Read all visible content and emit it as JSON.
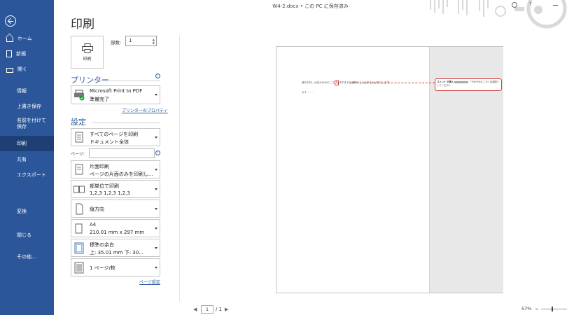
{
  "title_bar": "W4-2.docx • この PC に保存済み",
  "page_title": "印刷",
  "nav": {
    "items": [
      {
        "label": "ホーム"
      },
      {
        "label": "新規"
      },
      {
        "label": "開く"
      },
      {
        "label": "情報"
      },
      {
        "label": "上書き保存"
      },
      {
        "label": "名前を付けて保存"
      },
      {
        "label": "印刷"
      },
      {
        "label": "共有"
      },
      {
        "label": "エクスポート"
      },
      {
        "label": "変換"
      },
      {
        "label": "閉じる"
      },
      {
        "label": "その他..."
      }
    ],
    "selected": "印刷"
  },
  "print": {
    "button_label": "印刷",
    "copies_label": "部数:",
    "copies_value": "1"
  },
  "printer": {
    "heading": "プリンター",
    "name": "Microsoft Print to PDF",
    "status": "準備完了",
    "properties_link": "プリンターのプロパティ"
  },
  "settings": {
    "heading": "設定",
    "print_range": {
      "line1": "すべてのページを印刷",
      "line2": "ドキュメント全体"
    },
    "pages_label": "ページ:",
    "pages_value": "",
    "sides": {
      "line1": "片面印刷",
      "line2": "ページの片面のみを印刷し..."
    },
    "collate": {
      "line1": "部単位で印刷",
      "line2": "1,2,3    1,2,3    1,2,3"
    },
    "orientation": "縦方向",
    "paper": {
      "line1": "A4",
      "line2": "210.01 mm x 297 mm"
    },
    "margins": {
      "line1": "標準の余白",
      "line2": "上: 35.01 mm 下: 30..."
    },
    "pages_per_sheet": "1 ページ/枚",
    "page_setup_link": "ページ設定"
  },
  "preview": {
    "text_before": "我ちの村。",
    "text_middle": "は古かみのそこで",
    "marked": "凡",
    "text_after": "ますますと植物のことは年らかびありします。",
    "text_line2": "ます・・・",
    "comment_author": "コメント の挿入",
    "comment_text": "「やわやわにした」は誤記としてください"
  },
  "pager": {
    "current": "1",
    "total": "/ 1"
  },
  "zoom": {
    "level": "57%"
  }
}
